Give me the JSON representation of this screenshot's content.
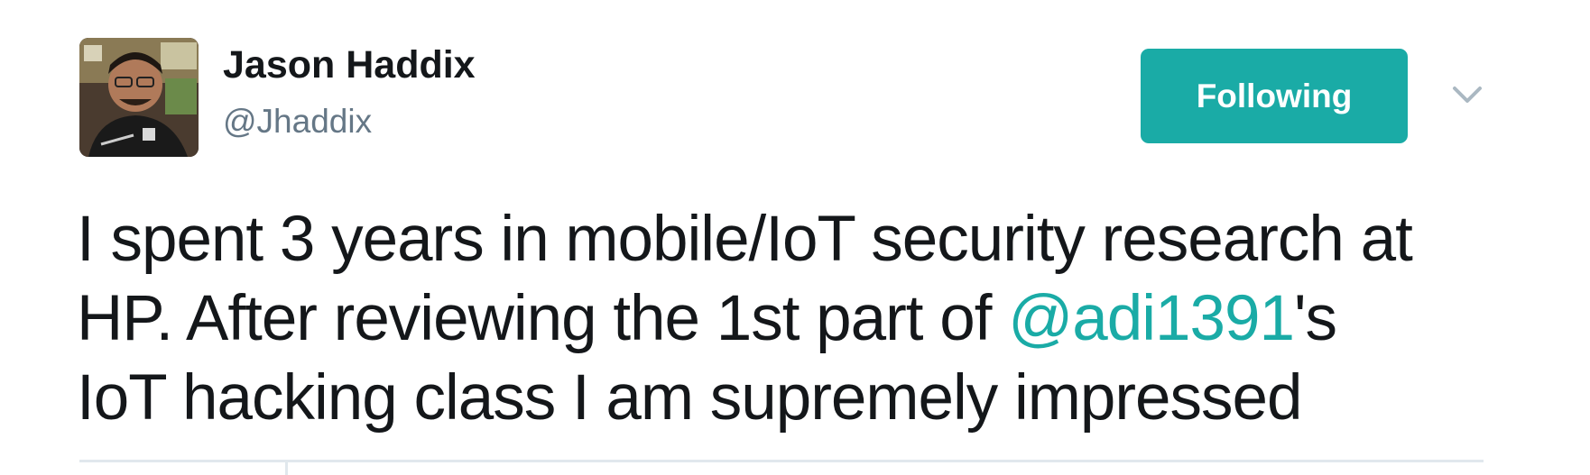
{
  "user": {
    "name": "Jason Haddix",
    "handle": "@Jhaddix"
  },
  "follow_button": {
    "label": "Following"
  },
  "tweet": {
    "line1": "I spent 3 years in mobile/IoT security research at",
    "line2_before": "HP. After reviewing the 1st part of ",
    "mention": "@adi1391",
    "line2_after": "'s",
    "line3": "IoT hacking class I am supremely impressed"
  },
  "icons": {
    "caret": "chevron-down-icon"
  },
  "colors": {
    "accent": "#1aaba6",
    "text": "#14171a",
    "secondary": "#657786",
    "divider": "#e1e8ed"
  }
}
